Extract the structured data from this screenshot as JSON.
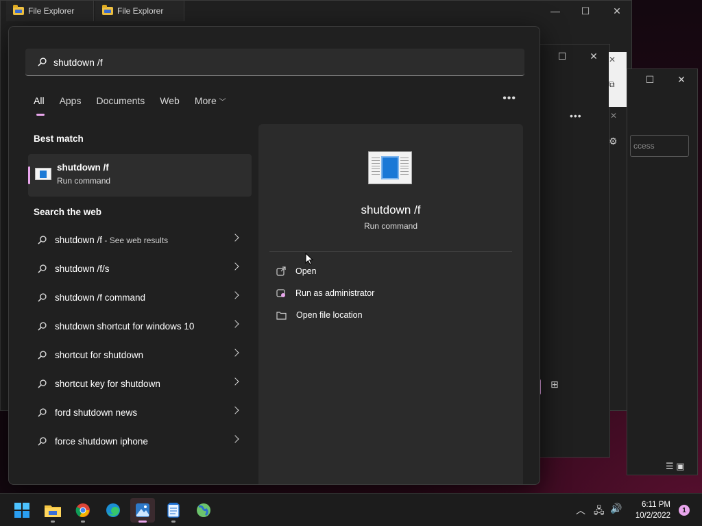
{
  "background_windows": {
    "explorer_tabs": [
      "File Explorer",
      "File Explorer"
    ],
    "access_field": "ccess"
  },
  "search": {
    "query": "shutdown /f"
  },
  "filters": {
    "tabs": [
      "All",
      "Apps",
      "Documents",
      "Web",
      "More"
    ],
    "active": "All"
  },
  "best_match": {
    "heading": "Best match",
    "title": "shutdown /f",
    "subtitle": "Run command"
  },
  "web": {
    "heading": "Search the web",
    "items": [
      {
        "bold": "shutdown /f",
        "rest": "",
        "sub": " - See web results"
      },
      {
        "bold": "shutdown /f/s",
        "rest": "",
        "sub": ""
      },
      {
        "bold": "shutdown /f command",
        "rest": "",
        "sub": ""
      },
      {
        "bold": "shutdown shortcut for windows 10",
        "rest": "",
        "sub": ""
      },
      {
        "bold": "shortcut for shutdown",
        "rest": "",
        "sub": ""
      },
      {
        "bold": "shortcut key for shutdown",
        "rest": "",
        "sub": ""
      },
      {
        "bold": "ford shutdown news",
        "rest": "",
        "sub": ""
      },
      {
        "bold": "force shutdown iphone",
        "rest": "",
        "sub": ""
      }
    ]
  },
  "preview": {
    "title": "shutdown /f",
    "subtitle": "Run command",
    "actions": [
      "Open",
      "Run as administrator",
      "Open file location"
    ]
  },
  "taskbar": {
    "apps": [
      "start-icon",
      "file-explorer-icon",
      "chrome-icon",
      "edge-icon",
      "photos-icon",
      "notepad-icon",
      "network-globe-icon"
    ],
    "time": "6:11 PM",
    "date": "10/2/2022",
    "notifications": "1"
  },
  "colors": {
    "accent": "#e9a6ec",
    "panel": "#202020",
    "preview": "#2b2b2b"
  }
}
